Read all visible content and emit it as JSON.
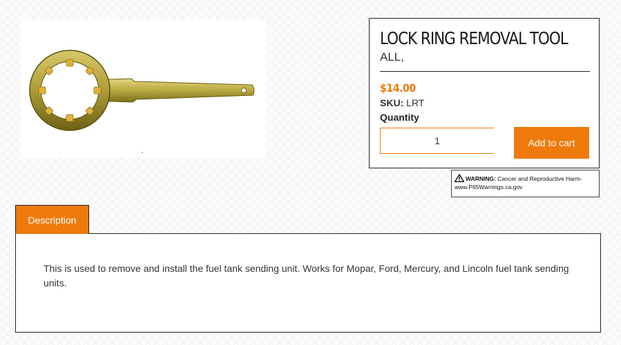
{
  "product": {
    "title": "LOCK RING REMOVAL TOOL",
    "subtitle": "ALL,",
    "price": "$14.00",
    "sku_label": "SKU:",
    "sku_value": "LRT",
    "quantity_label": "Quantity",
    "quantity_value": "1",
    "add_to_cart_label": "Add to cart",
    "image_icon": "lock-ring-wrench-icon"
  },
  "warning": {
    "label": "WARNING:",
    "text": "Cancer and Reproductive Harm-",
    "link": "www.P65Warnings.ca.gov"
  },
  "tabs": {
    "description_label": "Description"
  },
  "description": {
    "text": "This is used to remove and install the fuel tank sending unit. Works for Mopar, Ford, Mercury, and Lincoln fuel tank sending units."
  },
  "colors": {
    "accent": "#ee7a0b",
    "border": "#222222"
  }
}
